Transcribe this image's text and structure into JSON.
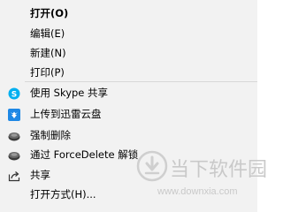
{
  "context_menu": {
    "items": [
      {
        "label": "打开(O)",
        "icon": null,
        "bold": true
      },
      {
        "label": "编辑(E)",
        "icon": null
      },
      {
        "label": "新建(N)",
        "icon": null
      },
      {
        "label": "打印(P)",
        "icon": null
      },
      {
        "label": "使用 Skype 共享",
        "icon": "skype-icon"
      },
      {
        "label": "上传到迅雷云盘",
        "icon": "xunlei-cloud-icon"
      },
      {
        "label": "强制删除",
        "icon": "disc-icon"
      },
      {
        "label": "通过 ForceDelete 解锁",
        "icon": "disc-icon"
      },
      {
        "label": "共享",
        "icon": "share-icon"
      },
      {
        "label": "打开方式(H)...",
        "icon": null
      }
    ]
  },
  "watermark": {
    "title": "当下软件园",
    "url": "www.downxia.com"
  },
  "colors": {
    "menu_background": "#f2f2f2",
    "separator": "#d8d8d8",
    "skype_blue": "#00aff0",
    "xunlei_blue": "#1e88e5",
    "watermark_gray": "#c9c9c9"
  }
}
